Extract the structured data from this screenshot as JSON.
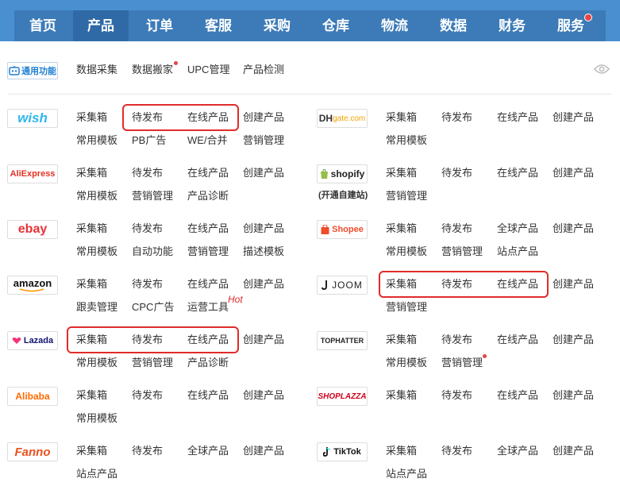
{
  "nav": {
    "items": [
      {
        "label": "首页"
      },
      {
        "label": "产品"
      },
      {
        "label": "订单"
      },
      {
        "label": "客服"
      },
      {
        "label": "采购"
      },
      {
        "label": "仓库"
      },
      {
        "label": "物流"
      },
      {
        "label": "数据"
      },
      {
        "label": "财务"
      },
      {
        "label": "服务"
      }
    ],
    "active_index": 1
  },
  "general": {
    "logo_label": "通用功能",
    "links": [
      "数据采集",
      "数据搬家",
      "UPC管理",
      "产品检测"
    ]
  },
  "platforms": {
    "wish": {
      "logo": "wish",
      "links": [
        "采集箱",
        "待发布",
        "在线产品",
        "创建产品",
        "常用模板",
        "PB广告",
        "WE/合并",
        "营销管理"
      ]
    },
    "aliexpress": {
      "logo": "AliExpress",
      "links": [
        "采集箱",
        "待发布",
        "在线产品",
        "创建产品",
        "常用模板",
        "营销管理",
        "产品诊断"
      ]
    },
    "ebay": {
      "logo": "ebay",
      "links": [
        "采集箱",
        "待发布",
        "在线产品",
        "创建产品",
        "常用模板",
        "自动功能",
        "营销管理",
        "描述模板"
      ]
    },
    "amazon": {
      "logo": "amazon",
      "links": [
        "采集箱",
        "待发布",
        "在线产品",
        "创建产品",
        "跟卖管理",
        "CPC广告",
        "运营工具"
      ],
      "hot": "Hot"
    },
    "lazada": {
      "logo": "Lazada",
      "links": [
        "采集箱",
        "待发布",
        "在线产品",
        "创建产品",
        "常用模板",
        "营销管理",
        "产品诊断"
      ]
    },
    "alibaba": {
      "logo": "Alibaba",
      "links": [
        "采集箱",
        "待发布",
        "在线产品",
        "创建产品",
        "常用模板"
      ]
    },
    "fanno": {
      "logo": "Fanno",
      "links": [
        "采集箱",
        "待发布",
        "全球产品",
        "创建产品",
        "站点产品"
      ]
    },
    "dhgate": {
      "logo_a": "DH",
      "logo_b": "gate.com",
      "links": [
        "采集箱",
        "待发布",
        "在线产品",
        "创建产品",
        "常用模板"
      ]
    },
    "shopify": {
      "logo": "shopify",
      "sublabel": "(开通自建站)",
      "links": [
        "采集箱",
        "待发布",
        "在线产品",
        "创建产品",
        "营销管理"
      ]
    },
    "shopee": {
      "logo": "Shopee",
      "links": [
        "采集箱",
        "待发布",
        "全球产品",
        "创建产品",
        "常用模板",
        "营销管理",
        "站点产品"
      ]
    },
    "joom": {
      "logo": "JOOM",
      "links": [
        "采集箱",
        "待发布",
        "在线产品",
        "创建产品",
        "营销管理"
      ]
    },
    "tophatter": {
      "logo": "TOPHATTER",
      "links": [
        "采集箱",
        "待发布",
        "在线产品",
        "创建产品",
        "常用模板",
        "营销管理"
      ]
    },
    "shoplazza": {
      "logo": "SHOPLAZZA",
      "links": [
        "采集箱",
        "待发布",
        "在线产品",
        "创建产品"
      ]
    },
    "tiktok": {
      "logo": "TikTok",
      "links": [
        "采集箱",
        "待发布",
        "全球产品",
        "创建产品",
        "站点产品"
      ]
    }
  },
  "colors": {
    "nav_bg": "#4a8fcf",
    "highlight": "#e02b2b",
    "wish": "#2fb7ec",
    "aliexpress": "#e43225",
    "amazon": "#ff9900",
    "lazada": "#0f146d",
    "alibaba": "#ff6a00",
    "fanno": "#e8501f",
    "shopee": "#ee4d2d"
  }
}
